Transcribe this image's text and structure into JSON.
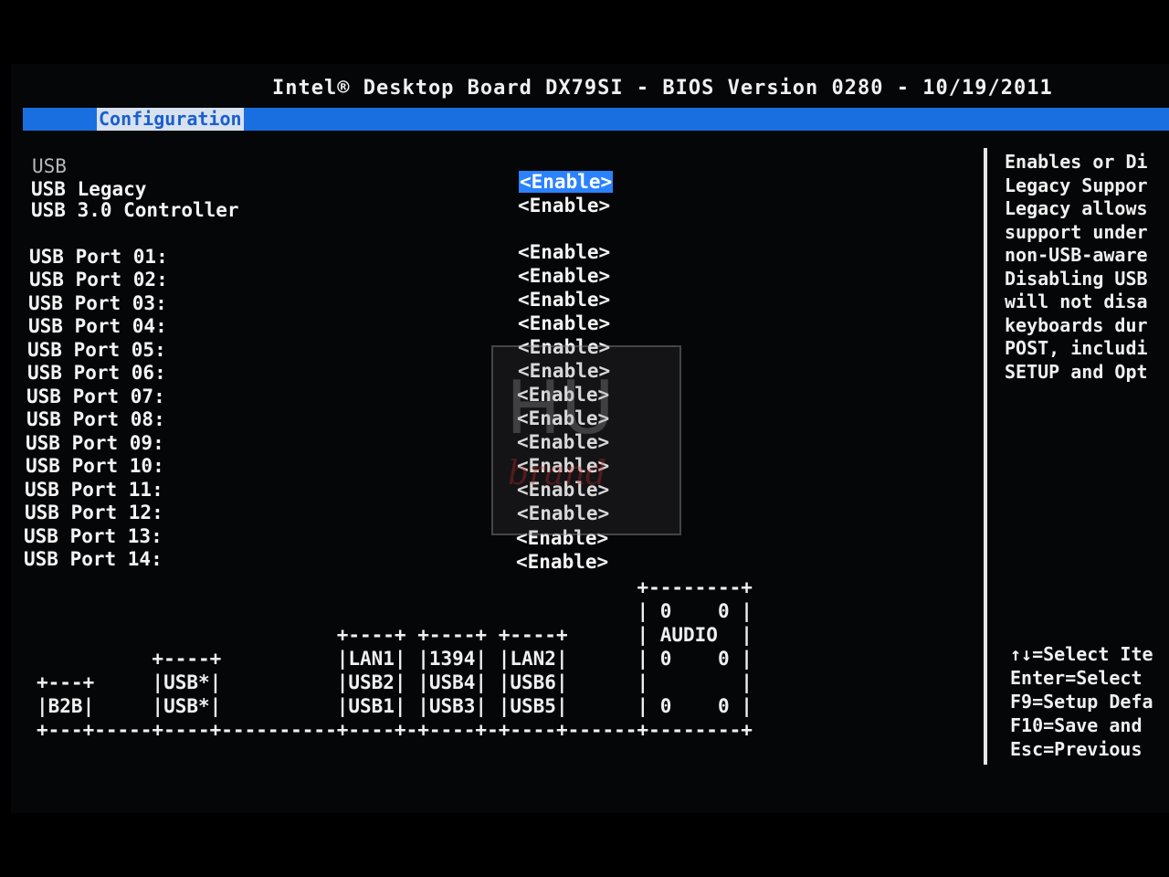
{
  "header": {
    "title": "Intel® Desktop Board DX79SI - BIOS Version 0280 - 10/19/2011"
  },
  "menu": {
    "active_tab": "Configuration"
  },
  "settings": {
    "section": "USB",
    "items": [
      {
        "label": "USB Legacy",
        "value": "<Enable>",
        "selected": true
      },
      {
        "label": "USB 3.0 Controller",
        "value": "<Enable>"
      },
      {
        "label": "USB Port 01:",
        "value": "<Enable>"
      },
      {
        "label": "USB Port 02:",
        "value": "<Enable>"
      },
      {
        "label": "USB Port 03:",
        "value": "<Enable>"
      },
      {
        "label": "USB Port 04:",
        "value": "<Enable>"
      },
      {
        "label": "USB Port 05:",
        "value": "<Enable>"
      },
      {
        "label": "USB Port 06:",
        "value": "<Enable>"
      },
      {
        "label": "USB Port 07:",
        "value": "<Enable>"
      },
      {
        "label": "USB Port 08:",
        "value": "<Enable>"
      },
      {
        "label": "USB Port 09:",
        "value": "<Enable>"
      },
      {
        "label": "USB Port 10:",
        "value": "<Enable>"
      },
      {
        "label": "USB Port 11:",
        "value": "<Enable>"
      },
      {
        "label": "USB Port 12:",
        "value": "<Enable>"
      },
      {
        "label": "USB Port 13:",
        "value": "<Enable>"
      },
      {
        "label": "USB Port 14:",
        "value": "<Enable>"
      }
    ]
  },
  "help": {
    "lines": [
      "Enables or Di",
      "Legacy Suppor",
      "Legacy allows",
      "support under",
      "non-USB-aware",
      "Disabling USB",
      "will not disa",
      "keyboards dur",
      "POST, includi",
      "SETUP and Opt"
    ]
  },
  "keys": {
    "lines": [
      "↑↓=Select Ite",
      "Enter=Select",
      "F9=Setup Defa",
      "F10=Save and",
      "Esc=Previous"
    ]
  },
  "port_diagram": {
    "rows": [
      "                                                    +--------+",
      "                                                    | 0    0 |",
      "                          +----+ +----+ +----+      | AUDIO  |",
      "          +----+          |LAN1| |1394| |LAN2|      | 0    0 |",
      "+---+     |USB*|          |USB2| |USB4| |USB6|      |        |",
      "|B2B|     |USB*|          |USB1| |USB3| |USB5|      | 0    0 |",
      "+---+-----+----+----------+----+-+----+-+----+------+--------+"
    ]
  },
  "watermark": {
    "logo_text": "HU",
    "logo_text_2": "brand"
  }
}
